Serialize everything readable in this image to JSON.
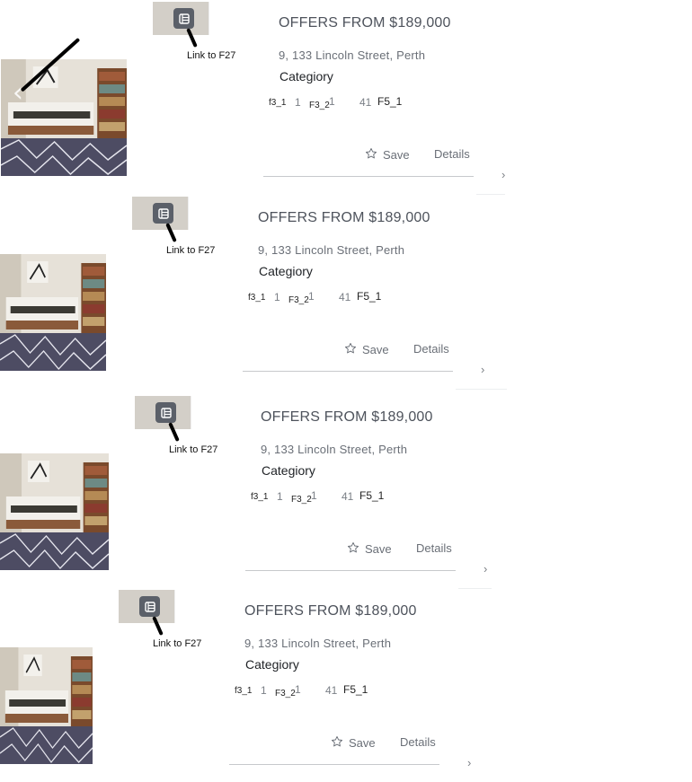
{
  "listings": [
    {
      "title": "OFFERS FROM $189,000",
      "address": "9, 133 Lincoln Street, Perth",
      "category": "Categiory",
      "link_label": "Link to F27",
      "f3_1": "f3_1",
      "num_a": "1",
      "f3_2": "F3_2",
      "num_b": "1",
      "num_c": "41",
      "f5_1": "F5_1",
      "save": "Save",
      "details": "Details"
    },
    {
      "title": "OFFERS FROM $189,000",
      "address": "9, 133 Lincoln Street, Perth",
      "category": "Categiory",
      "link_label": "Link to F27",
      "f3_1": "f3_1",
      "num_a": "1",
      "f3_2": "F3_2",
      "num_b": "1",
      "num_c": "41",
      "f5_1": "F5_1",
      "save": "Save",
      "details": "Details"
    },
    {
      "title": "OFFERS FROM $189,000",
      "address": "9, 133 Lincoln Street, Perth",
      "category": "Categiory",
      "link_label": "Link to F27",
      "f3_1": "f3_1",
      "num_a": "1",
      "f3_2": "F3_2",
      "num_b": "1",
      "num_c": "41",
      "f5_1": "F5_1",
      "save": "Save",
      "details": "Details"
    },
    {
      "title": "OFFERS FROM $189,000",
      "address": "9, 133 Lincoln Street, Perth",
      "category": "Categiory",
      "link_label": "Link to F27",
      "f3_1": "f3_1",
      "num_a": "1",
      "f3_2": "F3_2",
      "num_b": "1",
      "num_c": "41",
      "f5_1": "F5_1",
      "save": "Save",
      "details": "Details"
    }
  ],
  "icons": {
    "list": "list-icon",
    "save": "star-outline-icon",
    "next": "chevron-right-icon",
    "prev": "chevron-left-icon"
  },
  "colors": {
    "text": "#4e535c",
    "muted": "#6a6f77",
    "icon_bg": "#5b6069",
    "divider": "#c7c9cc"
  }
}
